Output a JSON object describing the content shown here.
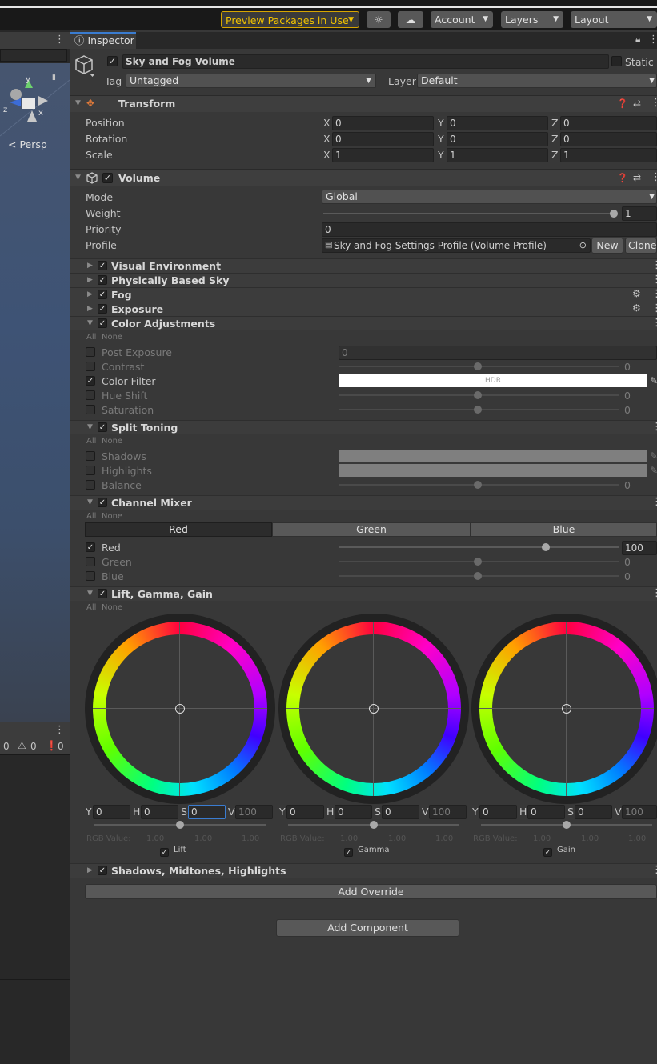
{
  "toolbar": {
    "preview_label": "Preview Packages in Use",
    "account_label": "Account",
    "layers_label": "Layers",
    "layout_label": "Layout"
  },
  "scene": {
    "persp_label": "Persp"
  },
  "console": {
    "count_info": "0",
    "count_warn": "0",
    "count_error": "0"
  },
  "inspector": {
    "tab_label": "Inspector",
    "object_name": "Sky and Fog Volume",
    "static_label": "Static",
    "tag_label": "Tag",
    "tag_value": "Untagged",
    "layer_label": "Layer",
    "layer_value": "Default"
  },
  "transform": {
    "title": "Transform",
    "position_label": "Position",
    "rotation_label": "Rotation",
    "scale_label": "Scale",
    "x": "X",
    "y": "Y",
    "z": "Z",
    "position": [
      "0",
      "0",
      "0"
    ],
    "rotation": [
      "0",
      "0",
      "0"
    ],
    "scale": [
      "1",
      "1",
      "1"
    ]
  },
  "volume": {
    "title": "Volume",
    "mode_label": "Mode",
    "mode_value": "Global",
    "weight_label": "Weight",
    "weight_value": "1",
    "weight_fraction": 1.0,
    "priority_label": "Priority",
    "priority_value": "0",
    "profile_label": "Profile",
    "profile_value": "Sky and Fog Settings Profile (Volume Profile)",
    "new_label": "New",
    "clone_label": "Clone"
  },
  "overrides": {
    "visual_env": "Visual Environment",
    "pbs": "Physically Based Sky",
    "fog": "Fog",
    "exposure": "Exposure",
    "all": "All",
    "none": "None"
  },
  "color_adjustments": {
    "title": "Color Adjustments",
    "post_exposure_label": "Post Exposure",
    "post_exposure_value": "0",
    "contrast_label": "Contrast",
    "contrast_value": "0",
    "color_filter_label": "Color Filter",
    "hdr_label": "HDR",
    "hue_shift_label": "Hue Shift",
    "hue_shift_value": "0",
    "saturation_label": "Saturation",
    "saturation_value": "0"
  },
  "split_toning": {
    "title": "Split Toning",
    "shadows_label": "Shadows",
    "highlights_label": "Highlights",
    "balance_label": "Balance",
    "balance_value": "0"
  },
  "channel_mixer": {
    "title": "Channel Mixer",
    "tabs": [
      "Red",
      "Green",
      "Blue"
    ],
    "red_label": "Red",
    "red_value": "100",
    "green_label": "Green",
    "green_value": "0",
    "blue_label": "Blue",
    "blue_value": "0"
  },
  "lgg": {
    "title": "Lift, Gamma, Gain",
    "y": "Y",
    "h": "H",
    "s": "S",
    "v": "V",
    "rgb_label": "RGB Value:",
    "wheels": [
      {
        "name": "Lift",
        "y": "0",
        "h": "0",
        "s": "0",
        "v": "100",
        "r": "1.00",
        "g": "1.00",
        "b": "1.00"
      },
      {
        "name": "Gamma",
        "y": "0",
        "h": "0",
        "s": "0",
        "v": "100",
        "r": "1.00",
        "g": "1.00",
        "b": "1.00"
      },
      {
        "name": "Gain",
        "y": "0",
        "h": "0",
        "s": "0",
        "v": "100",
        "r": "1.00",
        "g": "1.00",
        "b": "1.00"
      }
    ]
  },
  "smh": {
    "title": "Shadows, Midtones, Highlights"
  },
  "buttons": {
    "add_override": "Add Override",
    "add_component": "Add Component"
  }
}
